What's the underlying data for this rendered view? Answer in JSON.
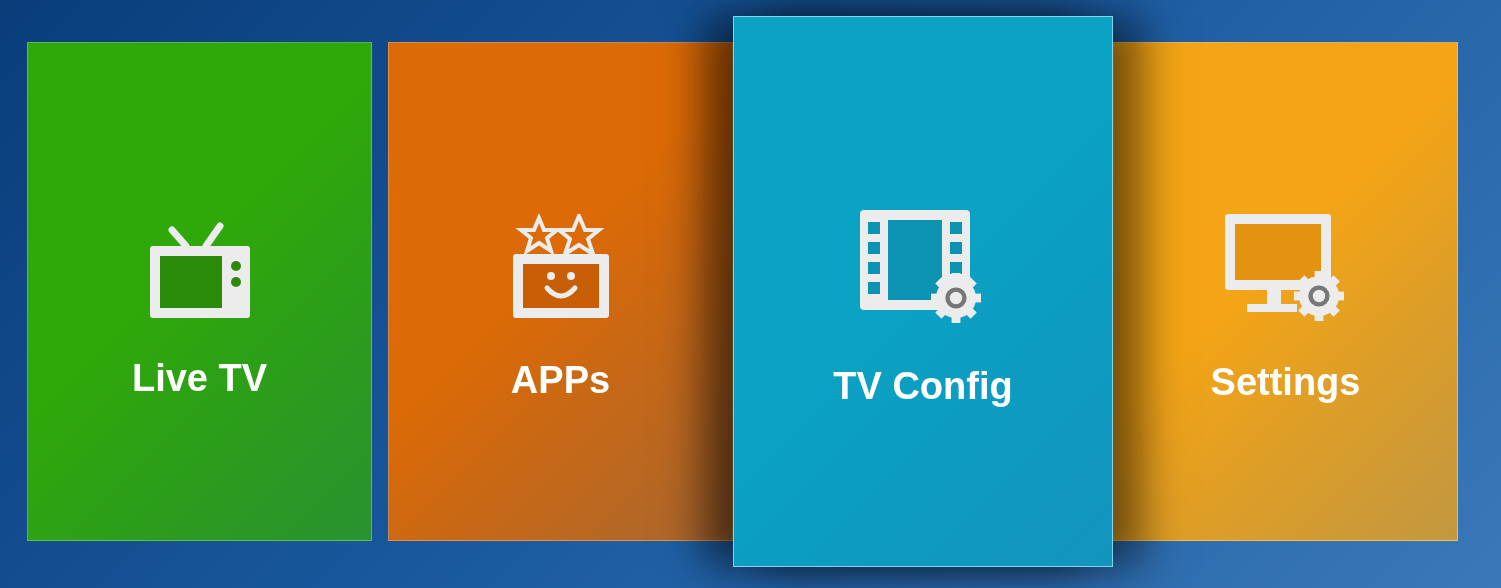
{
  "tiles": [
    {
      "label": "Live TV",
      "kind": "tv",
      "color": "#2fa80a",
      "selected": false
    },
    {
      "label": "APPs",
      "kind": "apps",
      "color": "#dc6a06",
      "selected": false
    },
    {
      "label": "TV Config",
      "kind": "config",
      "color": "#0aa3c4",
      "selected": true
    },
    {
      "label": "Settings",
      "kind": "settings",
      "color": "#f4a416",
      "selected": false
    }
  ]
}
